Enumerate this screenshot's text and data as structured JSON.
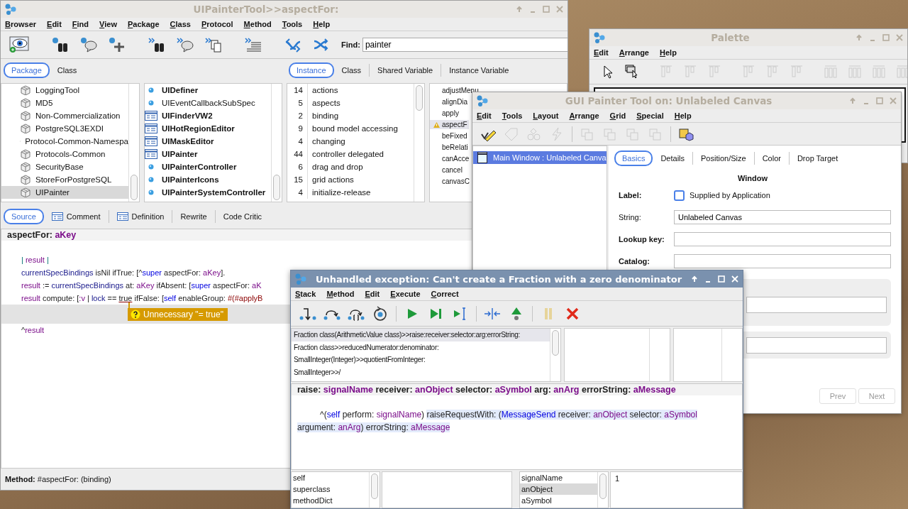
{
  "browser": {
    "title": "UIPainterTool>>aspectFor:",
    "active": false,
    "menu": [
      "Browser",
      "Edit",
      "Find",
      "View",
      "Package",
      "Class",
      "Protocol",
      "Method",
      "Tools",
      "Help"
    ],
    "find": {
      "label": "Find:",
      "value": "painter"
    },
    "view_tabs": [
      {
        "label": "Package",
        "selected": true
      },
      {
        "label": "Class",
        "selected": false
      }
    ],
    "side_tabs": [
      {
        "label": "Instance",
        "selected": true
      },
      {
        "label": "Class",
        "selected": false
      },
      {
        "label": "Shared Variable",
        "selected": false
      },
      {
        "label": "Instance Variable",
        "selected": false
      }
    ],
    "packages": [
      {
        "name": "LoggingTool",
        "selected": false
      },
      {
        "name": "MD5",
        "selected": false
      },
      {
        "name": "Non-Commercialization",
        "selected": false
      },
      {
        "name": "PostgreSQL3EXDI",
        "selected": false
      },
      {
        "name": "Protocol-Common-Namespa",
        "selected": false
      },
      {
        "name": "Protocols-Common",
        "selected": false
      },
      {
        "name": "SecurityBase",
        "selected": false
      },
      {
        "name": "StoreForPostgreSQL",
        "selected": false
      },
      {
        "name": "UIPainter",
        "selected": true
      }
    ],
    "classes": [
      {
        "name": "UIDefiner",
        "kind": "class",
        "emphasized": true
      },
      {
        "name": "UIEventCallbackSubSpec",
        "kind": "class",
        "emphasized": false
      },
      {
        "name": "UIFinderVW2",
        "kind": "application",
        "emphasized": true
      },
      {
        "name": "UIHotRegionEditor",
        "kind": "application",
        "emphasized": true
      },
      {
        "name": "UIMaskEditor",
        "kind": "application",
        "emphasized": true
      },
      {
        "name": "UIPainter",
        "kind": "application",
        "emphasized": true
      },
      {
        "name": "UIPainterController",
        "kind": "class",
        "emphasized": true
      },
      {
        "name": "UIPainterIcons",
        "kind": "class",
        "emphasized": true
      },
      {
        "name": "UIPainterSystemController",
        "kind": "class",
        "emphasized": true
      }
    ],
    "protocols": [
      {
        "count": "14",
        "name": "actions"
      },
      {
        "count": "5",
        "name": "aspects"
      },
      {
        "count": "2",
        "name": "binding"
      },
      {
        "count": "9",
        "name": "bound model accessing"
      },
      {
        "count": "4",
        "name": "changing"
      },
      {
        "count": "44",
        "name": "controller delegated"
      },
      {
        "count": "6",
        "name": "drag and drop"
      },
      {
        "count": "15",
        "name": "grid actions"
      },
      {
        "count": "4",
        "name": "initialize-release"
      }
    ],
    "methods": [
      {
        "name": "adjustMenu",
        "selected": false,
        "flagged": false
      },
      {
        "name": "alignDia",
        "selected": false,
        "flagged": false
      },
      {
        "name": "apply",
        "selected": false,
        "flagged": false
      },
      {
        "name": "aspectF",
        "selected": true,
        "flagged": true
      },
      {
        "name": "beFixed",
        "selected": false,
        "flagged": false
      },
      {
        "name": "beRelati",
        "selected": false,
        "flagged": false
      },
      {
        "name": "canAcce",
        "selected": false,
        "flagged": false
      },
      {
        "name": "cancel",
        "selected": false,
        "flagged": false
      },
      {
        "name": "canvasC",
        "selected": false,
        "flagged": false
      }
    ],
    "source_tabs": [
      {
        "label": "Source",
        "selected": true,
        "kind": "plain"
      },
      {
        "label": "Comment",
        "selected": false,
        "kind": "iconic"
      },
      {
        "label": "Definition",
        "selected": false,
        "kind": "iconic"
      },
      {
        "label": "Rewrite",
        "selected": false,
        "kind": "plain"
      },
      {
        "label": "Code Critic",
        "selected": false,
        "kind": "plain"
      }
    ],
    "code": {
      "heading": [
        {
          "kind": "plain",
          "text": "aspectFor: "
        },
        {
          "kind": "temp",
          "text": "aKey"
        }
      ],
      "lines": [
        {
          "kind": "blank"
        },
        {
          "kind": "code",
          "tokens": [
            {
              "kind": "bar",
              "text": "\t| "
            },
            {
              "kind": "temp",
              "text": "result"
            },
            {
              "kind": "bar",
              "text": " |"
            }
          ]
        },
        {
          "kind": "code",
          "tokens": [
            {
              "kind": "ivar",
              "text": "\tcurrentSpecBindings"
            },
            {
              "kind": "plain",
              "text": " isNil ifTrue: [^"
            },
            {
              "kind": "pseudo",
              "text": "super"
            },
            {
              "kind": "plain",
              "text": " aspectFor: "
            },
            {
              "kind": "temp",
              "text": "aKey"
            },
            {
              "kind": "plain",
              "text": "]."
            }
          ]
        },
        {
          "kind": "code",
          "tokens": [
            {
              "kind": "temp",
              "text": "\tresult"
            },
            {
              "kind": "plain",
              "text": " := "
            },
            {
              "kind": "ivar",
              "text": "currentSpecBindings"
            },
            {
              "kind": "plain",
              "text": " at: "
            },
            {
              "kind": "temp",
              "text": "aKey"
            },
            {
              "kind": "plain",
              "text": " ifAbsent: ["
            },
            {
              "kind": "pseudo",
              "text": "super"
            },
            {
              "kind": "plain",
              "text": " aspectFor: "
            },
            {
              "kind": "temp",
              "text": "aK"
            }
          ]
        },
        {
          "kind": "code",
          "tokens": [
            {
              "kind": "temp",
              "text": "\tresult"
            },
            {
              "kind": "plain",
              "text": " compute: ["
            },
            {
              "kind": "temp",
              "text": ":v"
            },
            {
              "kind": "plain",
              "text": " | "
            },
            {
              "kind": "ivar",
              "text": "lock"
            },
            {
              "kind": "plain",
              "text": " == "
            },
            {
              "kind": "flagged",
              "text": "true"
            },
            {
              "kind": "plain",
              "text": " ifFalse: ["
            },
            {
              "kind": "pseudo",
              "text": "self"
            },
            {
              "kind": "plain",
              "text": " enableGroup: "
            },
            {
              "kind": "literal",
              "text": "#(#applyB"
            }
          ]
        },
        {
          "kind": "hint",
          "text": "Unnecessary \"= true\""
        },
        {
          "kind": "code",
          "tokens": [
            {
              "kind": "plain",
              "text": "\t^"
            },
            {
              "kind": "temp",
              "text": "result"
            }
          ]
        }
      ]
    },
    "status": "**Method:** #aspectFor: (binding)"
  },
  "palette": {
    "title": "Palette",
    "active": false,
    "menu": [
      "Edit",
      "Arrange",
      "Help"
    ],
    "toolbar": [
      {
        "disabled": false
      },
      {
        "disabled": false
      },
      {
        "disabled": true
      },
      {
        "disabled": true
      },
      {
        "disabled": true
      },
      {
        "disabled": true
      },
      {
        "disabled": true
      },
      {
        "disabled": true
      },
      {
        "disabled": true
      },
      {
        "disabled": true
      },
      {
        "disabled": true
      },
      {
        "disabled": true
      }
    ]
  },
  "painter": {
    "title": "GUI Painter Tool on: Unlabeled Canvas",
    "active": false,
    "menu": [
      "Edit",
      "Tools",
      "Layout",
      "Arrange",
      "Grid",
      "Special",
      "Help"
    ],
    "toolbar": [
      {
        "disabled": false
      },
      {
        "disabled": true
      },
      {
        "disabled": true
      },
      {
        "disabled": true
      },
      {
        "disabled": true
      },
      {
        "disabled": true
      },
      {
        "disabled": true
      },
      {
        "disabled": true
      },
      {
        "disabled": false
      }
    ],
    "tree": [
      {
        "label": "Main Window : Unlabeled Canva",
        "selected": true
      }
    ],
    "tabs": [
      {
        "label": "Basics",
        "selected": true
      },
      {
        "label": "Details",
        "selected": false
      },
      {
        "label": "Position/Size",
        "selected": false
      },
      {
        "label": "Color",
        "selected": false
      },
      {
        "label": "Drop Target",
        "selected": false
      }
    ],
    "heading": "Window",
    "label_row": {
      "label": "Label:",
      "checkbox": "Supplied by Application",
      "checked": false
    },
    "fields": [
      {
        "label": "String:",
        "value": "Unlabeled Canvas",
        "bold": false
      },
      {
        "label": "Lookup key:",
        "bold": true
      },
      {
        "label": "Catalog:",
        "bold": true
      }
    ],
    "buttons": [
      {
        "label": "Prev",
        "disabled": true
      },
      {
        "label": "Next",
        "disabled": true
      }
    ]
  },
  "debugger": {
    "title": "Unhandled exception: Can't create a Fraction with a zero denominator",
    "active": true,
    "menu": [
      "Stack",
      "Method",
      "Edit",
      "Execute",
      "Correct"
    ],
    "stack": [
      {
        "label": "Fraction class(ArithmeticValue class)>>raise:receiver:selector:arg:errorString:",
        "selected": true
      },
      {
        "label": "Fraction class>>reducedNumerator:denominator:",
        "selected": false
      },
      {
        "label": "SmallInteger(Integer)>>quotientFromInteger:",
        "selected": false
      },
      {
        "label": "SmallInteger>>/",
        "selected": false
      }
    ],
    "code": {
      "heading": [
        {
          "kind": "plain",
          "text": "raise: "
        },
        {
          "kind": "temp",
          "text": "signalName"
        },
        {
          "kind": "plain",
          "text": " receiver: "
        },
        {
          "kind": "temp",
          "text": "anObject"
        },
        {
          "kind": "plain",
          "text": " selector: "
        },
        {
          "kind": "temp",
          "text": "aSymbol"
        },
        {
          "kind": "plain",
          "text": " arg: "
        },
        {
          "kind": "temp",
          "text": "anArg"
        },
        {
          "kind": "plain",
          "text": " errorString: "
        },
        {
          "kind": "temp",
          "text": "aMessage"
        }
      ],
      "lines": [
        {
          "kind": "blank"
        },
        {
          "kind": "code",
          "segments": [
            {
              "highlighted": false,
              "tokens": [
                {
                  "kind": "plain",
                  "text": "\t^("
                },
                {
                  "kind": "pseudo",
                  "text": "self"
                },
                {
                  "kind": "plain",
                  "text": " perform: "
                },
                {
                  "kind": "temp",
                  "text": "signalName"
                },
                {
                  "kind": "plain",
                  "text": ") "
                }
              ]
            },
            {
              "highlighted": true,
              "tokens": [
                {
                  "kind": "plain",
                  "text": "raiseRequestWith: ("
                },
                {
                  "kind": "pseudo",
                  "text": "MessageSend"
                },
                {
                  "kind": "plain",
                  "text": " receiver: "
                },
                {
                  "kind": "temp",
                  "text": "anObject"
                },
                {
                  "kind": "plain",
                  "text": " selector: "
                },
                {
                  "kind": "temp",
                  "text": "aSymbol"
                }
              ]
            }
          ]
        },
        {
          "kind": "code",
          "segments": [
            {
              "highlighted": true,
              "tokens": [
                {
                  "kind": "plain",
                  "text": "argument: "
                },
                {
                  "kind": "temp",
                  "text": "anArg"
                },
                {
                  "kind": "plain",
                  "text": ") errorString: "
                },
                {
                  "kind": "temp",
                  "text": "aMessage"
                }
              ]
            }
          ]
        }
      ]
    },
    "receiver_fields": [
      {
        "label": "self",
        "selected": false
      },
      {
        "label": "superclass",
        "selected": false
      },
      {
        "label": "methodDict",
        "selected": false
      }
    ],
    "context_fields": [
      {
        "label": "signalName",
        "selected": false
      },
      {
        "label": "anObject",
        "selected": true
      },
      {
        "label": "aSymbol",
        "selected": false
      }
    ],
    "value": "1"
  }
}
